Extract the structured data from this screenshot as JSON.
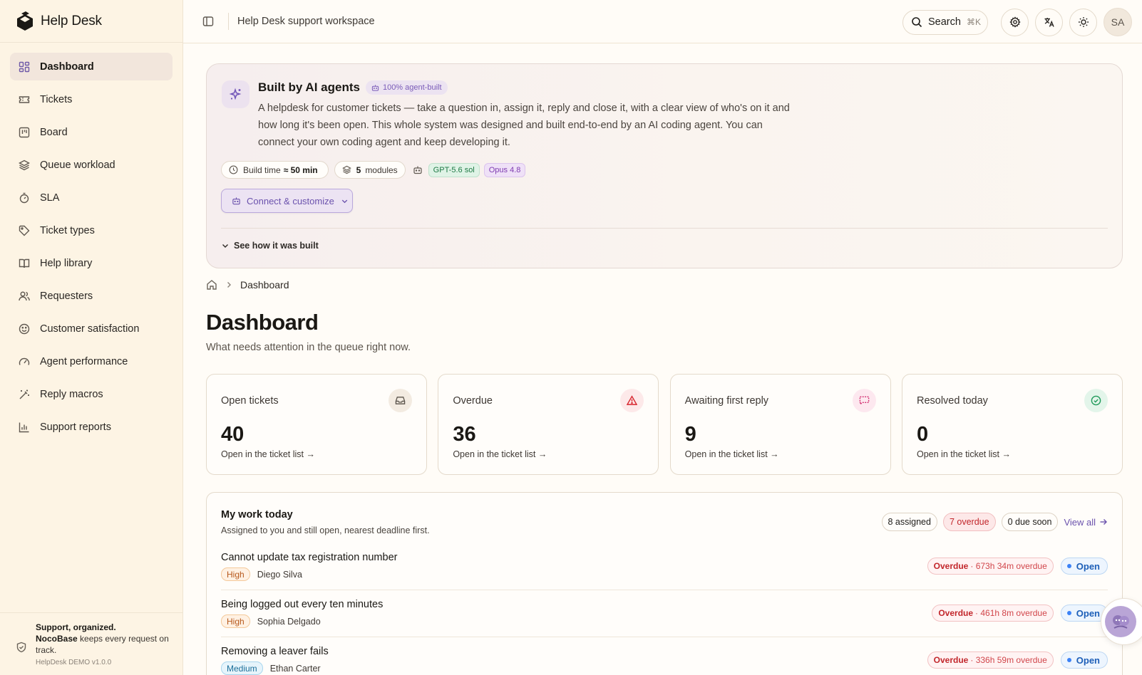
{
  "brand": {
    "name": "Help Desk"
  },
  "sidebar": {
    "items": [
      {
        "label": "Dashboard",
        "icon": "dashboard-icon",
        "active": true
      },
      {
        "label": "Tickets",
        "icon": "ticket-icon"
      },
      {
        "label": "Board",
        "icon": "board-icon"
      },
      {
        "label": "Queue workload",
        "icon": "layers-icon"
      },
      {
        "label": "SLA",
        "icon": "timer-icon"
      },
      {
        "label": "Ticket types",
        "icon": "tag-icon"
      },
      {
        "label": "Help library",
        "icon": "book-icon"
      },
      {
        "label": "Requesters",
        "icon": "users-icon"
      },
      {
        "label": "Customer satisfaction",
        "icon": "smile-icon"
      },
      {
        "label": "Agent performance",
        "icon": "gauge-icon"
      },
      {
        "label": "Reply macros",
        "icon": "wand-icon"
      },
      {
        "label": "Support reports",
        "icon": "bar-chart-icon"
      }
    ],
    "footer": {
      "headline": "Support, organized.",
      "brand": "NocoBase",
      "tagline": "keeps every request on track.",
      "version": "HelpDesk DEMO v1.0.0"
    }
  },
  "topbar": {
    "workspace": "Help Desk support workspace",
    "search_label": "Search",
    "search_shortcut": "⌘K",
    "avatar_initials": "SA"
  },
  "hero": {
    "title": "Built by AI agents",
    "badge": "100% agent-built",
    "description": "A helpdesk for customer tickets — take a question in, assign it, reply and close it, with a clear view of who's on it and how long it's been open. This whole system was designed and built end-to-end by an AI coding agent. You can connect your own coding agent and keep developing it.",
    "build_time_label": "Build time",
    "build_time_value": "≈ 50 min",
    "modules_count": "5",
    "modules_label": "modules",
    "models": [
      "GPT-5.6 sol",
      "Opus 4.8"
    ],
    "connect_label": "Connect & customize",
    "built_link": "See how it was built"
  },
  "breadcrumb": {
    "current": "Dashboard"
  },
  "page": {
    "title": "Dashboard",
    "subtitle": "What needs attention in the queue right now."
  },
  "cards": [
    {
      "label": "Open tickets",
      "value": "40",
      "link": "Open in the ticket list →",
      "icon": "inbox-icon",
      "accent": "#5b544c",
      "bg": "#f3ebe1"
    },
    {
      "label": "Overdue",
      "value": "36",
      "link": "Open in the ticket list →",
      "icon": "alert-triangle-icon",
      "accent": "#d7262e",
      "bg": "#fde9e9"
    },
    {
      "label": "Awaiting first reply",
      "value": "9",
      "link": "Open in the ticket list →",
      "icon": "message-dashed-icon",
      "accent": "#d12a6e",
      "bg": "#fde8ef"
    },
    {
      "label": "Resolved today",
      "value": "0",
      "link": "Open in the ticket list →",
      "icon": "check-circle-icon",
      "accent": "#1f9a5a",
      "bg": "#e3f5ea"
    }
  ],
  "work": {
    "title": "My work today",
    "subtitle": "Assigned to you and still open, nearest deadline first.",
    "badges": {
      "assigned": "8 assigned",
      "overdue": "7 overdue",
      "due_soon": "0 due soon"
    },
    "view_all": "View all",
    "rows": [
      {
        "title": "Cannot update tax registration number",
        "priority": "High",
        "requester": "Diego Silva",
        "due_label": "Overdue",
        "due_detail": "· 673h 34m overdue",
        "status": "Open"
      },
      {
        "title": "Being logged out every ten minutes",
        "priority": "High",
        "requester": "Sophia Delgado",
        "due_label": "Overdue",
        "due_detail": "· 461h 8m overdue",
        "status": "Open"
      },
      {
        "title": "Removing a leaver fails",
        "priority": "Medium",
        "requester": "Ethan Carter",
        "due_label": "Overdue",
        "due_detail": "· 336h 59m overdue",
        "status": "Open"
      }
    ]
  }
}
